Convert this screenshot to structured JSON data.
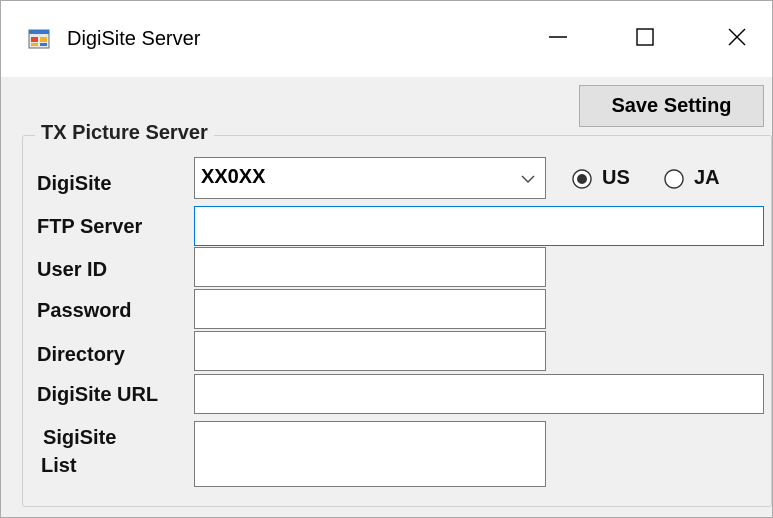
{
  "window": {
    "title": "DigiSite Server",
    "app_icon": "app-form-icon",
    "controls": {
      "minimize_icon": "minimize-icon",
      "maximize_icon": "maximize-icon",
      "close_icon": "close-icon"
    }
  },
  "toolbar": {
    "save_label": "Save Setting"
  },
  "group": {
    "title": "TX Picture Server",
    "fields": {
      "digisite": {
        "label": "DigiSite",
        "value": "XX0XX"
      },
      "ftp_server": {
        "label": "FTP Server",
        "value": ""
      },
      "user_id": {
        "label": "User ID",
        "value": ""
      },
      "password": {
        "label": "Password",
        "value": ""
      },
      "directory": {
        "label": "Directory",
        "value": ""
      },
      "digisite_url": {
        "label": "DigiSite URL",
        "value": ""
      },
      "sigisite_list": {
        "label_line1": "SigiSite",
        "label_line2": "List",
        "value": ""
      }
    },
    "region": {
      "options": [
        {
          "label": "US",
          "selected": true
        },
        {
          "label": "JA",
          "selected": false
        }
      ]
    }
  },
  "colors": {
    "window_bg": "#f0f0f0",
    "titlebar_bg": "#ffffff",
    "focus_border": "#0078d7",
    "button_bg": "#e1e1e1"
  }
}
